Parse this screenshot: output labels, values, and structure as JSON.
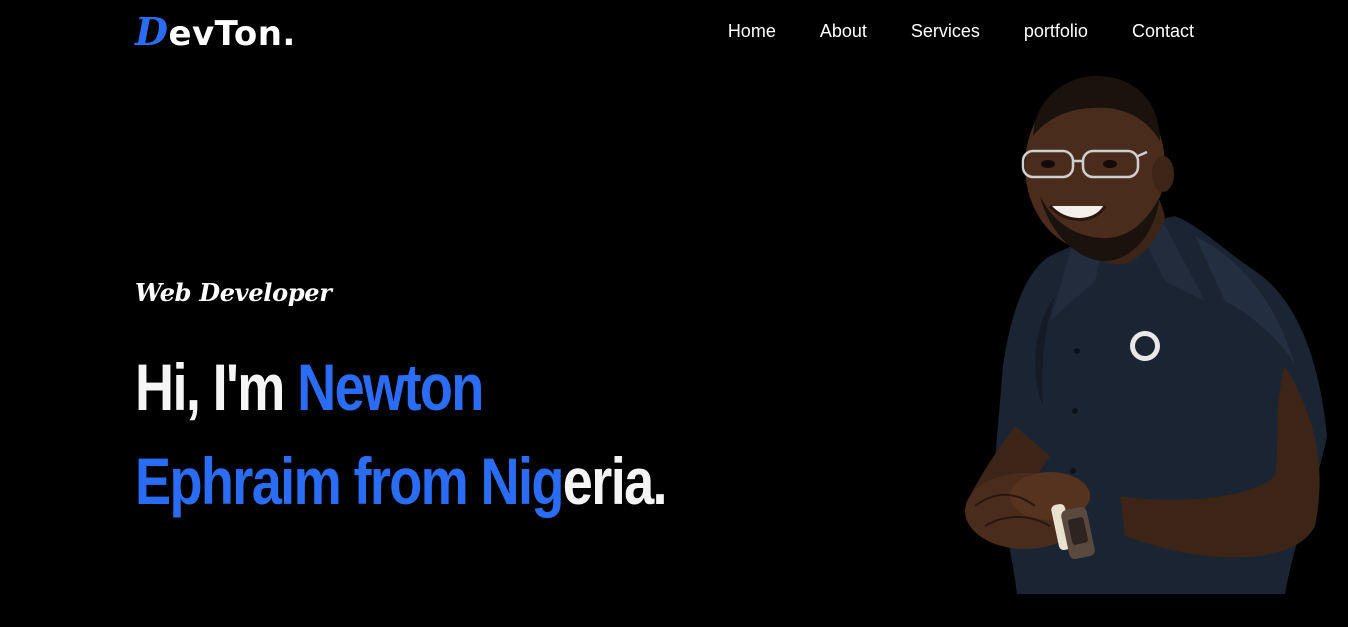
{
  "brand": {
    "logo_first": "D",
    "logo_rest": "evTon."
  },
  "nav": {
    "items": [
      "Home",
      "About",
      "Services",
      "portfolio",
      "Contact"
    ]
  },
  "hero": {
    "role": "Web Developer",
    "line1": {
      "white": "Hi, I'm ",
      "blue": "Newton"
    },
    "line2": {
      "blue": "Ephraim from Nig",
      "white": "eria."
    }
  },
  "colors": {
    "background": "#000000",
    "accent": "#2a6df4",
    "text": "#ffffff"
  }
}
